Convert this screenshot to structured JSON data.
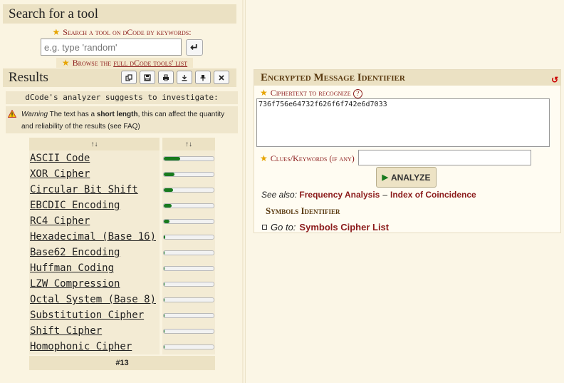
{
  "search": {
    "title": "Search for a tool",
    "keywords_label": "Search a tool on dCode by keywords:",
    "placeholder": "e.g. type 'random'",
    "enter_icon": "enter-icon",
    "browse_prefix": "Browse the ",
    "browse_link": "full dCode tools' list"
  },
  "results": {
    "title": "Results",
    "toolbar_icons": [
      "copy-icon",
      "save-icon",
      "print-icon",
      "download-icon",
      "pin-icon",
      "close-icon"
    ],
    "analyzer_text": "dCode's analyzer suggests to investigate:",
    "warning_label": "Warning",
    "warning_pre": " The text has a ",
    "warning_bold": "short length",
    "warning_post": ", this can affect the quantity and reliability of the results (see FAQ)",
    "columns": [
      "↑↓",
      "↑↓"
    ],
    "rows": [
      {
        "name": "ASCII Code",
        "score": 0.33
      },
      {
        "name": "XOR Cipher",
        "score": 0.22
      },
      {
        "name": "Circular Bit Shift",
        "score": 0.19
      },
      {
        "name": "EBCDIC Encoding",
        "score": 0.15
      },
      {
        "name": "RC4 Cipher",
        "score": 0.12
      },
      {
        "name": "Hexadecimal (Base 16)",
        "score": 0.03
      },
      {
        "name": "Base62 Encoding",
        "score": 0.02
      },
      {
        "name": "Huffman Coding",
        "score": 0.02
      },
      {
        "name": "LZW Compression",
        "score": 0.02
      },
      {
        "name": "Octal System (Base 8)",
        "score": 0.02
      },
      {
        "name": "Substitution Cipher",
        "score": 0.01
      },
      {
        "name": "Shift Cipher",
        "score": 0.01
      },
      {
        "name": "Homophonic Cipher",
        "score": 0.01
      }
    ],
    "footer": "#13"
  },
  "identifier": {
    "title": "Encrypted Message Identifier",
    "reset_icon": "reset-icon",
    "ciphertext_label": "Ciphertext to recognize",
    "help": "?",
    "ciphertext_value": "736f756e64732f626f6f742e6d7033",
    "clues_label": "Clues/Keywords (if any)",
    "clues_value": "",
    "analyze_label": "ANALYZE",
    "see_also_label": "See also:",
    "see_also_links": [
      "Frequency Analysis",
      "Index of Coincidence"
    ],
    "see_also_sep": "–",
    "symbols_title": "Symbols Identifier",
    "goto_label": "Go to:",
    "goto_link": "Symbols Cipher List"
  },
  "colors": {
    "accent": "#8b1a1a",
    "bar_fill": "#187a1e",
    "panel_header": "#ebe1c3",
    "background": "#faf4e1"
  }
}
